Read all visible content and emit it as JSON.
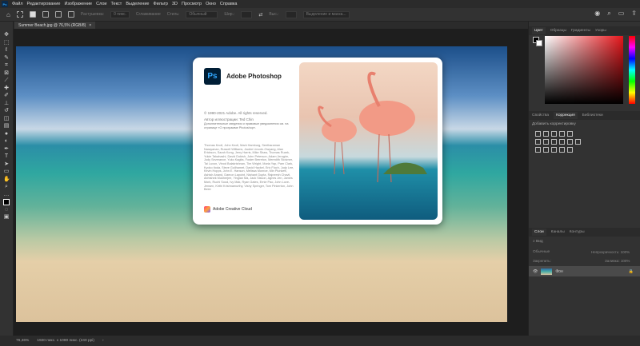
{
  "menu": {
    "logo": "Ps",
    "items": [
      "Файл",
      "Редактирование",
      "Изображение",
      "Слои",
      "Текст",
      "Выделение",
      "Фильтр",
      "3D",
      "Просмотр",
      "Окно",
      "Справка"
    ]
  },
  "options": {
    "feather_label": "Растушевка:",
    "feather_value": "0 пикс.",
    "antialias": "Сглаживание",
    "style_label": "Стиль:",
    "style_value": "Обычный",
    "width_label": "Шир.:",
    "height_label": "Выс.:",
    "select_mask": "Выделение и маска..."
  },
  "document": {
    "tab": "Summer Beach.jpg @ 76,5% (RGB/8)",
    "close": "×"
  },
  "about": {
    "logo": "Ps",
    "title": "Adobe Photoshop",
    "copyright": "© 1990-2021 Adobe. All rights reserved.",
    "artist": "Автор иллюстрации: Ted Chin",
    "legal": "Дополнительные сведения и правовые уведомления см. на странице «О программе Photoshop».",
    "credits": "Thomas Knoll, John Knoll, Mark Hamburg, Seetharaman Narayanan, Russell Williams, Jackie Lincoln-Owyang, Alan Erickson, Sarah Kong, Jerry Harris, Mike Shaw, Thomas Ruark, Yukie Takahashi, David Dobish, John Peterson, Adam Jerugim, Judy Severance, Yuko Kagita, Foster Brereton, Meredith Stotzner, Tai Luxon, Vinod Balakrishnan, Tim Wright, Maria Yap, Pam Clark, Kyoko Itoda, Steve Guilhamet, David Hackel, Eric Floch, Judy Lee, Kevin Hopps, John E. Hanson, Melissa Monroe, Min Plunkett, Ashish Anand, Damon Lapoint, Nishant Gupta, Rajneesh Chavli, Abhishek Mukherjee, Yinglan Ma, Jack Sisson, Agnes Jen, James Mork, Ruchi Sood, Ivy Mak, Ryan Gates, Ernie Pao, John Love-Jensen, Kirthi Krishnamurthy, Vishy Springer, Tom Pinkerton, John Beier",
    "cc": "Adobe Creative Cloud"
  },
  "panels": {
    "color_tabs": [
      "Цвет",
      "Образцы",
      "Градиенты",
      "Узоры"
    ],
    "adj_tabs": [
      "Свойства",
      "Коррекция",
      "Библиотеки"
    ],
    "adj_label": "Добавить корректировку",
    "layer_tabs": [
      "Слои",
      "Каналы",
      "Контуры"
    ],
    "layer_search": "Вид",
    "blend": "Обычные",
    "opacity_label": "Непрозрачность:",
    "opacity": "100%",
    "lock_label": "Закрепить:",
    "fill_label": "Заливка:",
    "fill": "100%",
    "layer_name": "Фон"
  },
  "status": {
    "zoom": "76,46%",
    "size": "1920 пикс. x 1080 пикс. (240 ppi)"
  }
}
